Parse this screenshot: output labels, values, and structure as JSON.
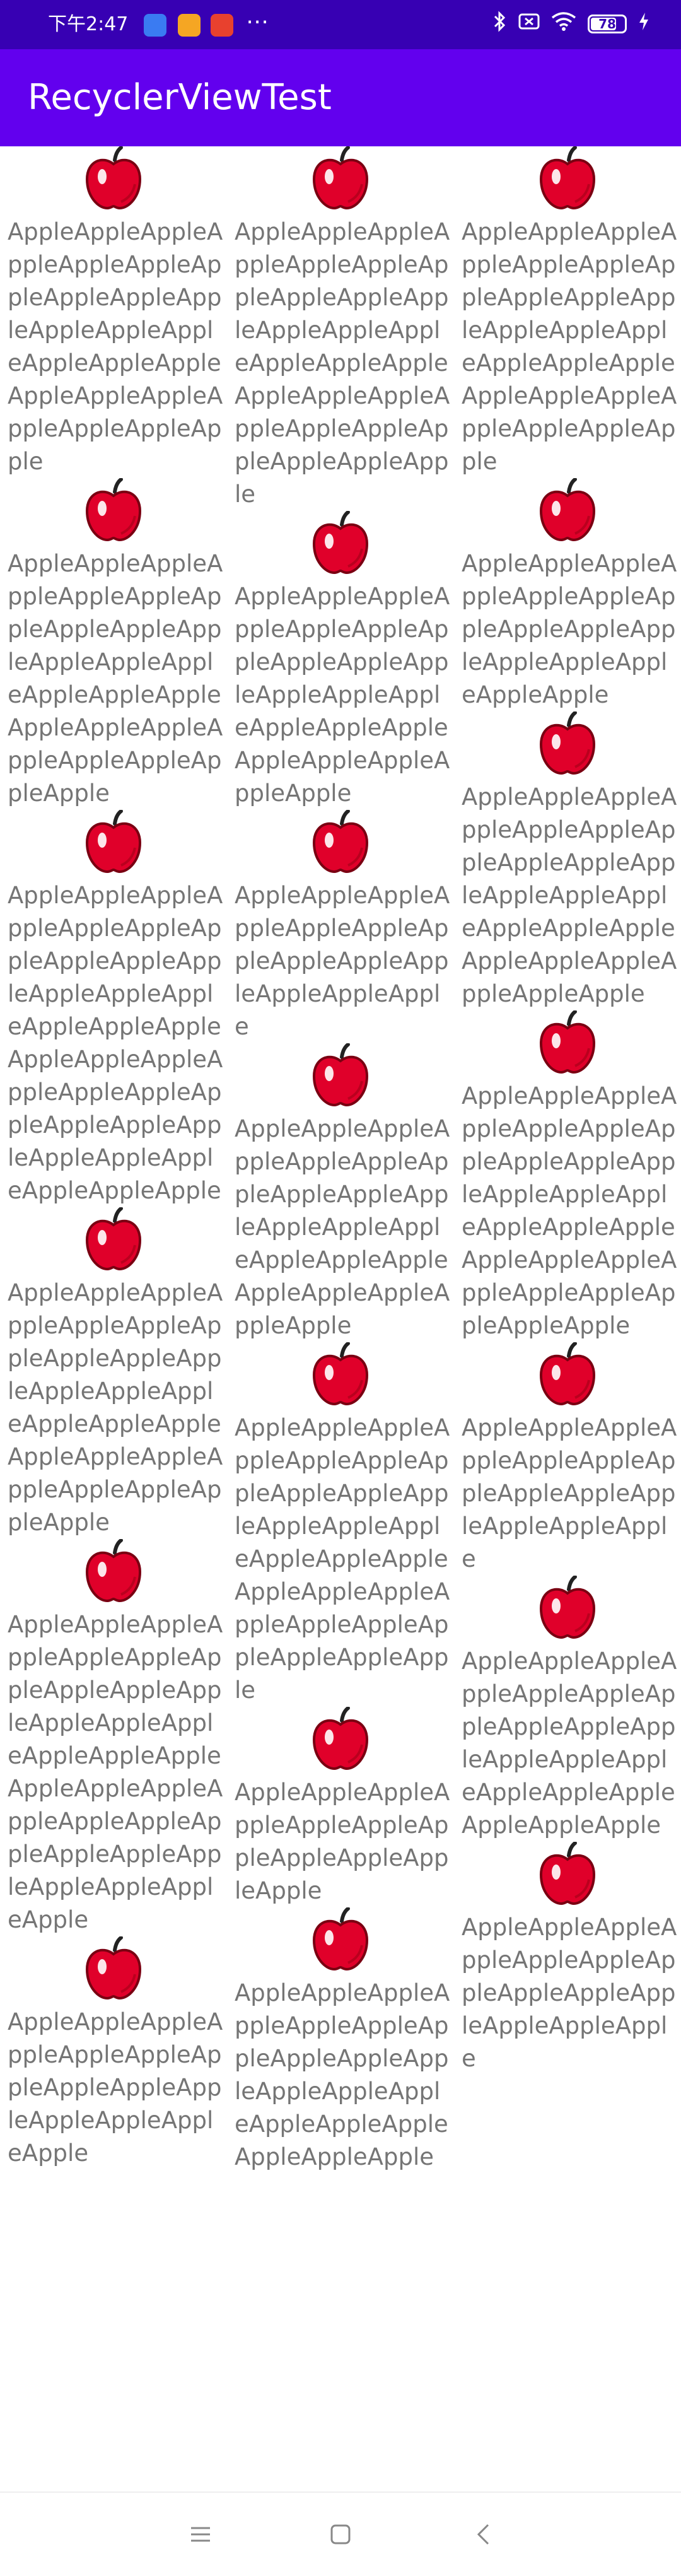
{
  "status_bar": {
    "time": "下午2:47",
    "battery": "78",
    "left_icons": [
      "app-notification-icon-1",
      "app-notification-icon-2",
      "app-notification-icon-3"
    ],
    "right_icons": [
      "bluetooth-icon",
      "sim-icon",
      "wifi-icon",
      "battery-icon",
      "charging-icon"
    ]
  },
  "app_bar": {
    "title": "RecyclerViewTest"
  },
  "colors": {
    "status_bar": "#3700B3",
    "app_bar": "#6200EE",
    "item_text": "#757575",
    "apple": "#E0002A"
  },
  "items": [
    {
      "col": 0,
      "name": "AppleAppleAppleAppleAppleAppleAppleAppleAppleAppleAppleAppleAppleAppleAppleAppleAppleAppleAppleAppleAppleAppleApple"
    },
    {
      "col": 1,
      "name": "AppleAppleAppleAppleAppleAppleAppleAppleAppleAppleAppleAppleAppleAppleAppleAppleAppleAppleAppleAppleAppleAppleAppleAppleAppleApple"
    },
    {
      "col": 2,
      "name": "AppleAppleAppleAppleAppleAppleAppleAppleAppleAppleAppleAppleAppleAppleAppleAppleAppleAppleAppleAppleAppleAppleApple"
    },
    {
      "col": 0,
      "name": "AppleAppleAppleAppleAppleAppleAppleAppleAppleAppleAppleAppleAppleAppleAppleAppleAppleAppleAppleAppleAppleAppleAppleApple"
    },
    {
      "col": 1,
      "name": "AppleAppleAppleAppleAppleAppleAppleAppleAppleAppleAppleAppleAppleAppleAppleAppleAppleAppleAppleAppleApple"
    },
    {
      "col": 2,
      "name": "AppleAppleAppleAppleAppleAppleAppleAppleAppleAppleAppleAppleAppleAppleApple"
    },
    {
      "col": 2,
      "name": "AppleAppleAppleAppleAppleAppleAppleAppleAppleAppleAppleAppleAppleAppleAppleAppleAppleAppleAppleAppleAppleApple"
    },
    {
      "col": 0,
      "name": "AppleAppleAppleAppleAppleAppleAppleAppleAppleAppleAppleAppleAppleAppleAppleAppleAppleAppleAppleAppleAppleAppleAppleAppleAppleAppleAppleAppleAppleAppleAppleApple"
    },
    {
      "col": 1,
      "name": "AppleAppleAppleAppleAppleAppleAppleAppleAppleAppleAppleAppleApple"
    },
    {
      "col": 1,
      "name": "AppleAppleAppleAppleAppleAppleAppleAppleAppleAppleAppleAppleAppleAppleAppleAppleAppleAppleAppleAppleApple"
    },
    {
      "col": 2,
      "name": "AppleAppleAppleAppleAppleAppleAppleAppleAppleAppleAppleAppleAppleAppleAppleAppleAppleAppleAppleAppleAppleAppleAppleAppleApple"
    },
    {
      "col": 0,
      "name": "AppleAppleAppleAppleAppleAppleAppleAppleAppleAppleAppleAppleAppleAppleAppleAppleAppleAppleAppleAppleAppleAppleAppleApple"
    },
    {
      "col": 1,
      "name": "AppleAppleAppleAppleAppleAppleAppleAppleAppleAppleAppleAppleAppleAppleAppleAppleAppleAppleAppleAppleAppleAppleAppleAppleAppleApple"
    },
    {
      "col": 2,
      "name": "AppleAppleAppleAppleAppleAppleAppleAppleAppleAppleAppleAppleApple"
    },
    {
      "col": 0,
      "name": "AppleAppleAppleAppleAppleAppleAppleAppleAppleAppleAppleAppleAppleAppleAppleAppleAppleAppleAppleAppleAppleAppleAppleAppleAppleAppleAppleAppleAppleApple"
    },
    {
      "col": 2,
      "name": "AppleAppleAppleAppleAppleAppleAppleAppleAppleAppleAppleAppleAppleAppleAppleAppleAppleAppleApple"
    },
    {
      "col": 1,
      "name": "AppleAppleAppleAppleAppleAppleAppleAppleAppleAppleApple"
    },
    {
      "col": 0,
      "name": "AppleAppleAppleAppleAppleAppleAppleAppleAppleAppleAppleAppleAppleApple"
    },
    {
      "col": 1,
      "name": "AppleAppleAppleAppleAppleAppleAppleAppleAppleAppleAppleAppleAppleAppleAppleAppleAppleAppleApple"
    },
    {
      "col": 2,
      "name": "AppleAppleAppleAppleAppleAppleAppleAppleAppleAppleAppleAppleApple"
    }
  ],
  "nav_bar": {
    "buttons": [
      "menu-icon",
      "home-icon",
      "back-icon"
    ]
  }
}
